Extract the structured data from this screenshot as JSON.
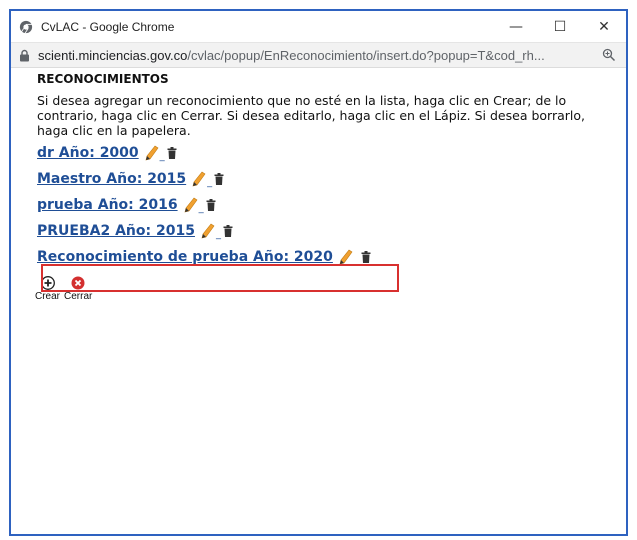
{
  "window": {
    "title": "CvLAC - Google Chrome",
    "controls": {
      "minimize": "—",
      "maximize": "☐",
      "close": "✕"
    }
  },
  "address": {
    "host": "scienti.minciencias.gov.co",
    "path": "/cvlac/popup/EnReconocimiento/insert.do?popup=T&cod_rh..."
  },
  "page": {
    "heading": "RECONOCIMIENTOS",
    "description": "Si desea agregar un reconocimiento que no esté en la lista, haga clic en Crear; de lo contrario, haga clic en Cerrar. Si desea editarlo, haga clic en el Lápiz. Si desea borrarlo, haga clic en la papelera.",
    "items": [
      {
        "label": "dr Año: 2000"
      },
      {
        "label": "Maestro Año: 2015"
      },
      {
        "label": "prueba Año: 2016"
      },
      {
        "label": "PRUEBA2 Año: 2015"
      },
      {
        "label": "Reconocimiento de prueba Año: 2020"
      }
    ],
    "separator": "_",
    "actions": {
      "create": "Crear",
      "close": "Cerrar"
    }
  },
  "colors": {
    "link": "#1f4e96",
    "highlight_border": "#d8302f",
    "window_border": "#2e62c0"
  }
}
